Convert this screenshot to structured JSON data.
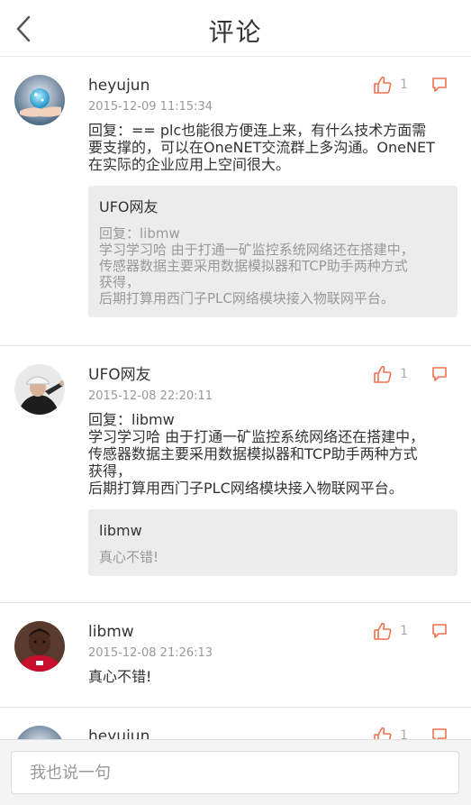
{
  "header": {
    "title": "评论",
    "back_icon": "chevron-left-icon"
  },
  "colors": {
    "accent": "#f0704e",
    "muted": "#999999",
    "quote_bg": "#ececec"
  },
  "comments": [
    {
      "user": "heyujun",
      "time": "2015-12-09 11:15:34",
      "likes": "1",
      "text_lines": [
        "回复：== plc也能很方便连上来，有什么技术方面需",
        "要支撑的，可以在OneNET交流群上多沟通。OneNET",
        "在实际的企业应用上空间很大。"
      ],
      "quote": {
        "user": "UFO网友",
        "text_lines": [
          "回复：libmw",
          "学习学习哈 由于打通一矿监控系统网络还在搭建中，",
          "传感器数据主要采用数据模拟器和TCP助手两种方式",
          "获得，",
          "后期打算用西门子PLC网络模块接入物联网平台。"
        ]
      }
    },
    {
      "user": "UFO网友",
      "time": "2015-12-08 22:20:11",
      "likes": "1",
      "text_lines": [
        "回复：libmw",
        "学习学习哈 由于打通一矿监控系统网络还在搭建中，",
        "传感器数据主要采用数据模拟器和TCP助手两种方式",
        "获得，",
        "后期打算用西门子PLC网络模块接入物联网平台。"
      ],
      "quote": {
        "user": "libmw",
        "text_lines": [
          "真心不错!"
        ]
      }
    },
    {
      "user": "libmw",
      "time": "2015-12-08 21:26:13",
      "likes": "1",
      "text_lines": [
        "真心不错!"
      ]
    },
    {
      "user": "heyujun",
      "likes": "1"
    }
  ],
  "footer": {
    "placeholder": "我也说一句"
  }
}
